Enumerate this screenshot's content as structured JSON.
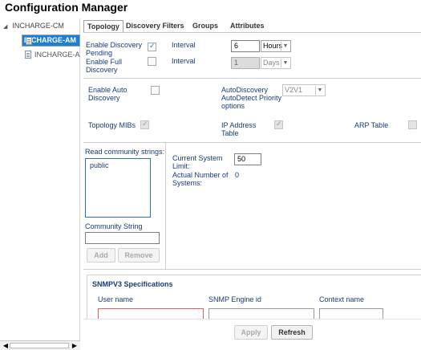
{
  "app": {
    "title": "Configuration Manager"
  },
  "tree": {
    "root_label": "INCHARGE-CM",
    "items": [
      {
        "label": "INCHARGE-AM",
        "selected": true
      },
      {
        "label": "INCHARGE-AM",
        "selected": false
      }
    ]
  },
  "tabs": [
    {
      "label": "Topology",
      "active": true
    },
    {
      "label": "Discovery Filters",
      "active": false
    },
    {
      "label": "Groups",
      "active": false
    },
    {
      "label": "Attributes",
      "active": false
    }
  ],
  "discovery": {
    "enable_pending_label": "Enable Discovery Pending",
    "enable_pending_checked": true,
    "interval1_label": "Interval",
    "interval1_value": "6",
    "interval1_unit": "Hours",
    "enable_full_label": "Enable Full Discovery",
    "enable_full_checked": false,
    "interval2_label": "Interval",
    "interval2_value": "1",
    "interval2_unit": "Days"
  },
  "auto": {
    "enable_auto_label": "Enable Auto Discovery",
    "enable_auto_checked": false,
    "priority_label": "AutoDiscovery AutoDetect Priority options",
    "priority_value": "V2V1"
  },
  "mibs": {
    "topology_mibs_label": "Topology MIBs",
    "ip_table_label": "IP Address Table",
    "arp_table_label": "ARP Table"
  },
  "community": {
    "read_label": "Read community strings:",
    "items": [
      "public"
    ],
    "string_label": "Community String",
    "string_value": "",
    "add_label": "Add",
    "remove_label": "Remove"
  },
  "limits": {
    "current_label": "Current System Limit:",
    "current_value": "50",
    "actual_label": "Actual Number of Systems:",
    "actual_value": "0"
  },
  "snmpv3": {
    "heading": "SNMPV3 Specifications",
    "col_user": "User name",
    "col_engine": "SNMP Engine id",
    "col_context": "Context name"
  },
  "footer": {
    "apply_label": "Apply",
    "refresh_label": "Refresh"
  }
}
